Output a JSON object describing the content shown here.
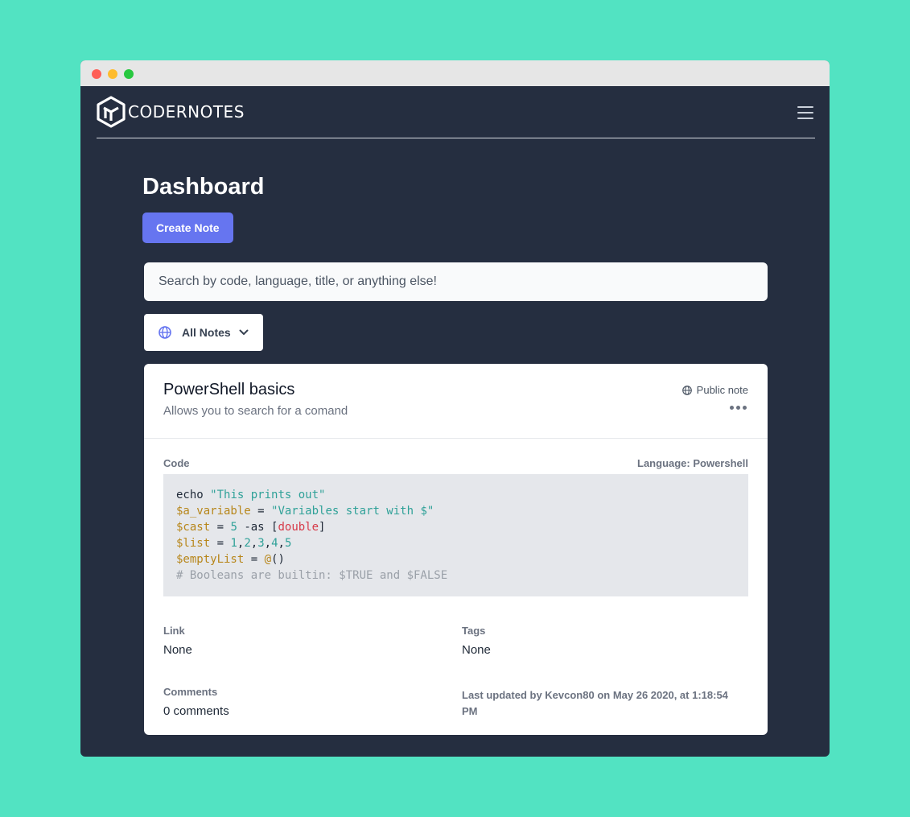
{
  "app": {
    "brand": "CODERNOTES"
  },
  "page": {
    "title": "Dashboard"
  },
  "actions": {
    "create_note_label": "Create Note"
  },
  "search": {
    "placeholder": "Search by code, language, title, or anything else!"
  },
  "filter": {
    "selected": "All Notes"
  },
  "note": {
    "title": "PowerShell basics",
    "description": "Allows you to search for a comand",
    "visibility": "Public note",
    "code_label": "Code",
    "language_label": "Language: Powershell",
    "code_lines": [
      "echo \"This prints out\"",
      "$a_variable = \"Variables start with $\"",
      "$cast = 5 -as [double]",
      "$list = 1,2,3,4,5",
      "$emptyList = @()",
      "# Booleans are builtin: $TRUE and $FALSE"
    ],
    "link_label": "Link",
    "link_value": "None",
    "tags_label": "Tags",
    "tags_value": "None",
    "comments_label": "Comments",
    "comments_value": "0 comments",
    "last_updated": "Last updated by Kevcon80 on May 26 2020, at 1:18:54 PM"
  },
  "colors": {
    "background": "#52e3c2",
    "window": "#252e40",
    "accent": "#6675f0"
  },
  "icons": {
    "logo": "hexagon-cube-logo",
    "menu": "hamburger-menu-icon",
    "filter": "globe-icon",
    "dropdown": "chevron-down-icon",
    "visibility": "globe-icon",
    "more": "more-horizontal-icon"
  }
}
